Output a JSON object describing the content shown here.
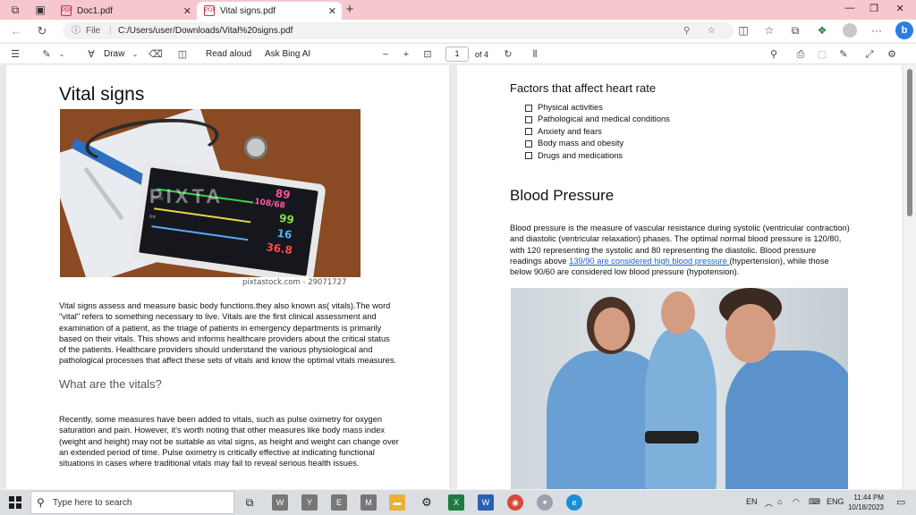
{
  "browser": {
    "tabs": [
      {
        "label": "Doc1.pdf",
        "close": "✕"
      },
      {
        "label": "Vital signs.pdf",
        "close": "✕"
      }
    ],
    "new_tab": "+",
    "url_info": "ⓘ",
    "url_scheme": "File",
    "url_sep": "|",
    "url_path": "C:/Users/user/Downloads/Vital%20signs.pdf",
    "bing_label": "b"
  },
  "pdf_toolbar": {
    "draw": "Draw",
    "read_aloud": "Read aloud",
    "ask_bing": "Ask Bing AI",
    "page": "1",
    "of_pages": "of 4",
    "zoom_out": "−",
    "zoom_in": "+"
  },
  "page_left": {
    "title": "Vital signs",
    "image_credit": "pixtastock.com - 29071727",
    "watermark": "PIXTA",
    "monitor_values": [
      "89",
      "108/68",
      "99",
      "16",
      "36.8"
    ],
    "monitor_labels": [
      "SpO2",
      "RR"
    ],
    "para1": "Vital signs assess and measure basic body functions.they also known as( vitals).The word \"vital\" refers to something necessary to live. Vitals are the first clinical assessment and examination of a patient, as the triage of patients in emergency departments is primarily based on their vitals. This shows and informs healthcare providers about the critical status of the patients. Healthcare providers should understand the various physiological and pathological processes that affect these sets of vitals and know the optimal vitals measures.",
    "heading2": "What are the vitals?",
    "para2": "Recently, some measures have been added to vitals, such as pulse oximetry for oxygen saturation and pain. However, it's worth noting that other measures like body mass index (weight and height) may not be suitable as vital signs, as height and weight can change over an extended period of time. Pulse oximetry is critically effective at indicating functional situations in cases where traditional vitals may fail to reveal serious health issues."
  },
  "page_right": {
    "heading1": "Factors that affect heart rate",
    "factors": [
      "Physical activities",
      "Pathological and medical conditions",
      "Anxiety and fears",
      "Body mass and obesity",
      "Drugs and medications"
    ],
    "heading2": "Blood Pressure",
    "bp_text_1": "Blood pressure is the measure of vascular resistance during systolic (ventricular contraction) and diastolic (ventricular relaxation) phases. The optimal normal blood pressure is 120/80, with 120 representing the systolic and 80 representing the diastolic. Blood pressure readings above ",
    "bp_link": "139/90 are considered high blood pressure ",
    "bp_text_2": "(hypertension), while those below 90/60 are considered low blood pressure (hypotension)."
  },
  "taskbar": {
    "search_placeholder": "Type here to search",
    "lang": "EN",
    "input_lang": "ENG",
    "time": "11:44 PM",
    "date": "10/18/2023"
  },
  "colors": {
    "titlebar": "#f6c7cf",
    "link": "#1b62c6",
    "accent": "#2a7de1"
  }
}
